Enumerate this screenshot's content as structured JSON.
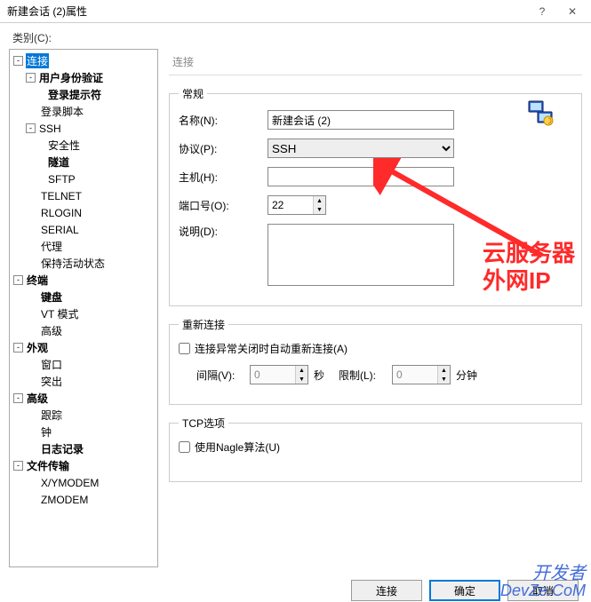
{
  "window_title": "新建会话 (2)属性",
  "category_label": "类别(C):",
  "tree": {
    "connection": "连接",
    "user_auth": "用户身份验证",
    "login_prompt": "登录提示符",
    "login_script": "登录脚本",
    "ssh": "SSH",
    "security": "安全性",
    "tunnel": "隧道",
    "sftp": "SFTP",
    "telnet": "TELNET",
    "rlogin": "RLOGIN",
    "serial": "SERIAL",
    "proxy": "代理",
    "keep_alive": "保持活动状态",
    "terminal": "终端",
    "keyboard": "键盘",
    "vt_mode": "VT 模式",
    "advanced_term": "高级",
    "appearance": "外观",
    "window": "窗口",
    "highlight": "突出",
    "advanced": "高级",
    "trace": "跟踪",
    "clock": "钟",
    "logging": "日志记录",
    "file_transfer": "文件传输",
    "xymodem": "X/YMODEM",
    "zmodem": "ZMODEM"
  },
  "section_title": "连接",
  "general": {
    "legend": "常规",
    "name_label": "名称(N):",
    "name_value": "新建会话 (2)",
    "protocol_label": "协议(P):",
    "protocol_value": "SSH",
    "host_label": "主机(H):",
    "host_value": "",
    "port_label": "端口号(O):",
    "port_value": "22",
    "desc_label": "说明(D):",
    "desc_value": ""
  },
  "reconnect": {
    "legend": "重新连接",
    "checkbox_label": "连接异常关闭时自动重新连接(A)",
    "interval_label": "间隔(V):",
    "interval_value": "0",
    "seconds": "秒",
    "limit_label": "限制(L):",
    "limit_value": "0",
    "minutes": "分钟"
  },
  "tcp": {
    "legend": "TCP选项",
    "nagle_label": "使用Nagle算法(U)"
  },
  "buttons": {
    "connect": "连接",
    "ok": "确定",
    "cancel": "取消"
  },
  "annotation": {
    "line1": "云服务器",
    "line2": "外网IP"
  },
  "watermark": {
    "l1": "开发者",
    "l2": "DevZe.CoM"
  }
}
